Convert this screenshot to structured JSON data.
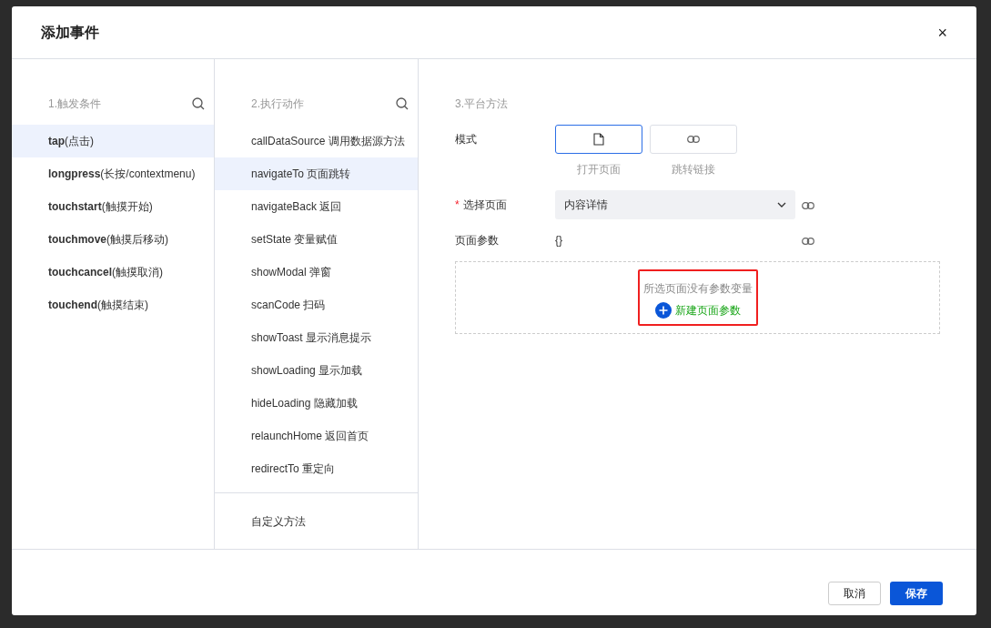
{
  "dialog": {
    "title": "添加事件",
    "close": "×"
  },
  "triggers": {
    "heading": "1.触发条件",
    "items": [
      {
        "label": "**tap**(点击)",
        "selected": true
      },
      {
        "label": "**longpress**(长按/contextmenu)",
        "selected": false
      },
      {
        "label": "**touchstart**(触摸开始)",
        "selected": false
      },
      {
        "label": "**touchmove**(触摸后移动)",
        "selected": false
      },
      {
        "label": "**touchcancel**(触摸取消)",
        "selected": false
      },
      {
        "label": "**touchend**(触摸结束)",
        "selected": false
      }
    ]
  },
  "actions": {
    "heading": "2.执行动作",
    "items": [
      {
        "label": "callDataSource 调用数据源方法",
        "selected": false
      },
      {
        "label": "navigateTo 页面跳转",
        "selected": true
      },
      {
        "label": "navigateBack 返回",
        "selected": false
      },
      {
        "label": "setState 变量赋值",
        "selected": false
      },
      {
        "label": "showModal 弹窗",
        "selected": false
      },
      {
        "label": "scanCode 扫码",
        "selected": false
      },
      {
        "label": "showToast 显示消息提示",
        "selected": false
      },
      {
        "label": "showLoading 显示加载",
        "selected": false
      },
      {
        "label": "hideLoading 隐藏加载",
        "selected": false
      },
      {
        "label": "relaunchHome 返回首页",
        "selected": false
      },
      {
        "label": "redirectTo 重定向",
        "selected": false
      }
    ],
    "custom": "自定义方法"
  },
  "method": {
    "heading": "3.平台方法",
    "mode_label": "模式",
    "modes": [
      {
        "kind": "page",
        "label": "打开页面",
        "selected": true
      },
      {
        "kind": "link",
        "label": "跳转链接",
        "selected": false
      }
    ],
    "page_required_mark": "*",
    "page_label": "选择页面",
    "page_value": "内容详情",
    "params_label": "页面参数",
    "params_value": "{}",
    "empty_state": {
      "message": "所选页面没有参数变量",
      "action": "新建页面参数",
      "highlighted": true
    }
  },
  "footer": {
    "buttons": [
      {
        "kind": "secondary",
        "label": "取消"
      },
      {
        "kind": "primary",
        "label": "保存"
      }
    ]
  }
}
